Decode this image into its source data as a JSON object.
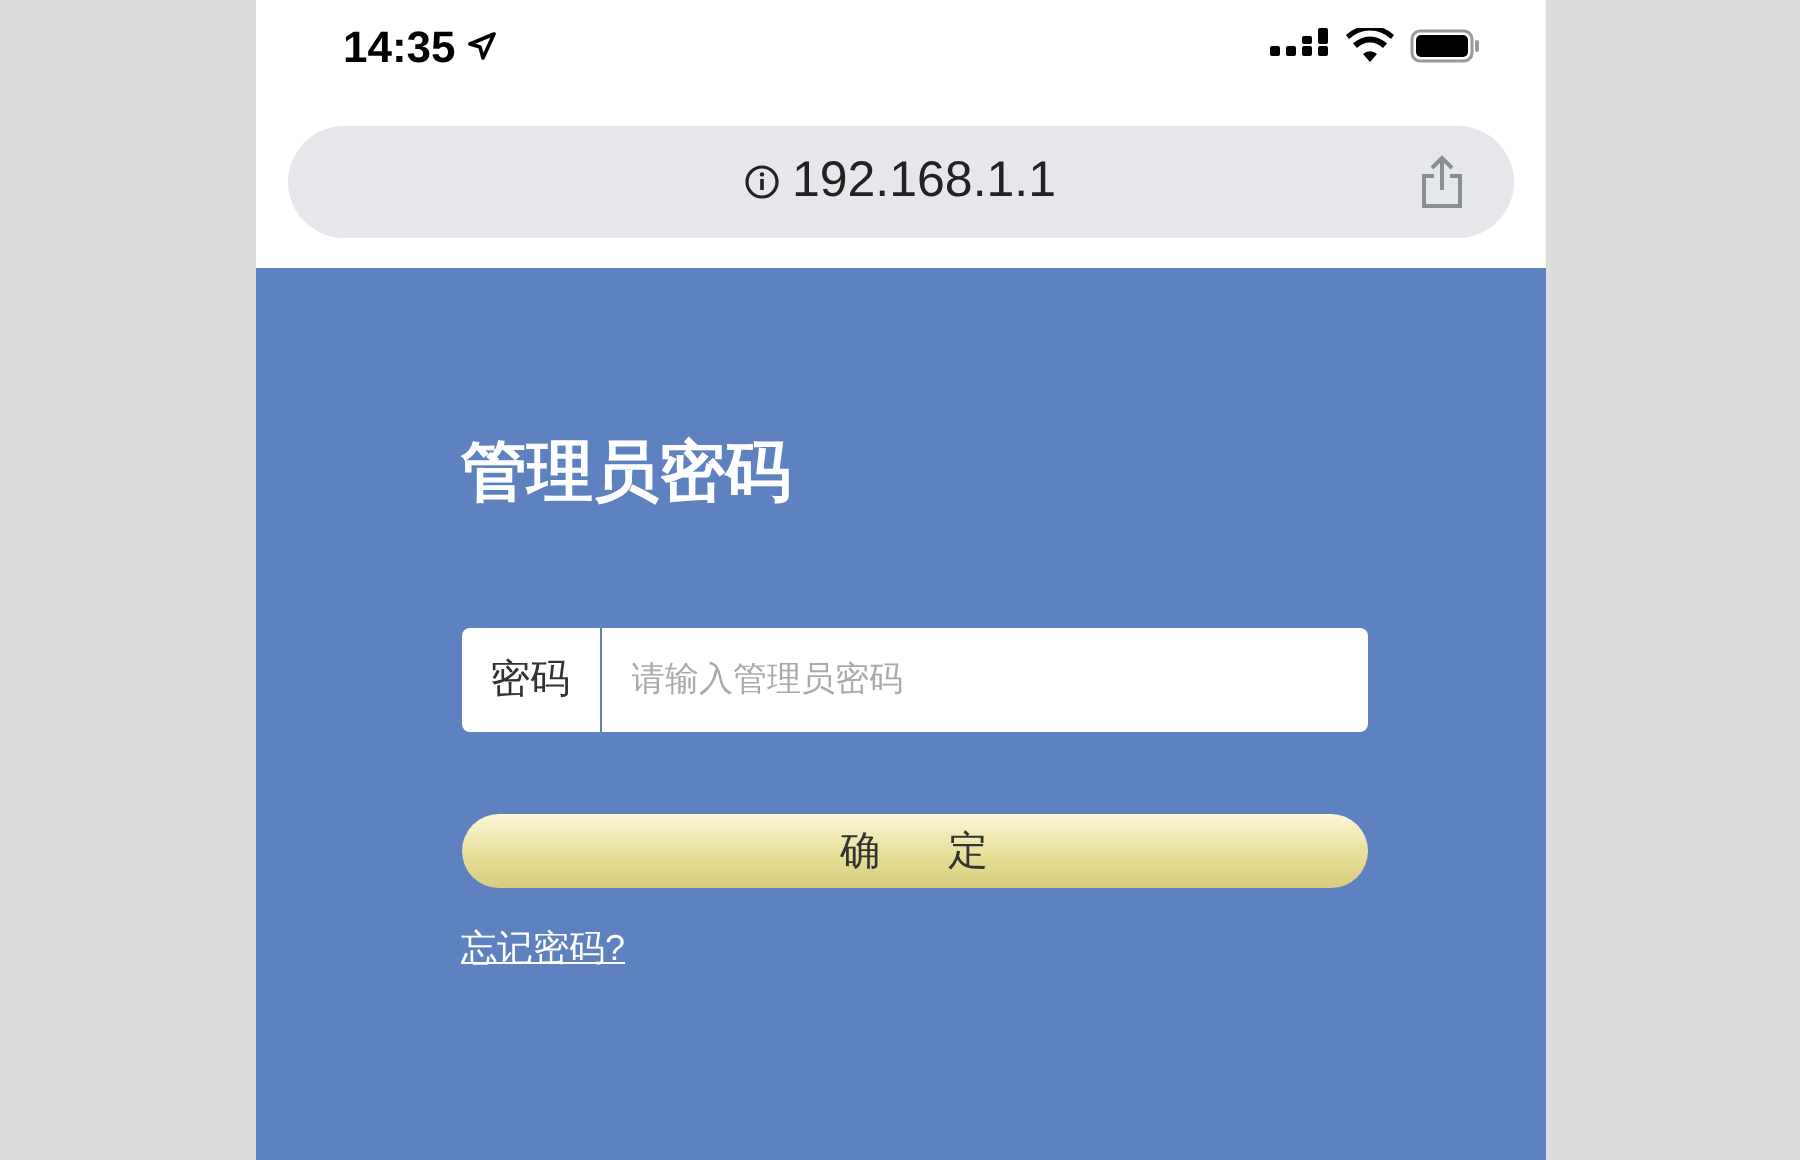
{
  "status_bar": {
    "time": "14:35"
  },
  "address_bar": {
    "url": "192.168.1.1"
  },
  "login": {
    "title": "管理员密码",
    "password_field": {
      "label": "密码",
      "placeholder": "请输入管理员密码"
    },
    "submit_button": "确 定",
    "forgot_link": "忘记密码?"
  }
}
